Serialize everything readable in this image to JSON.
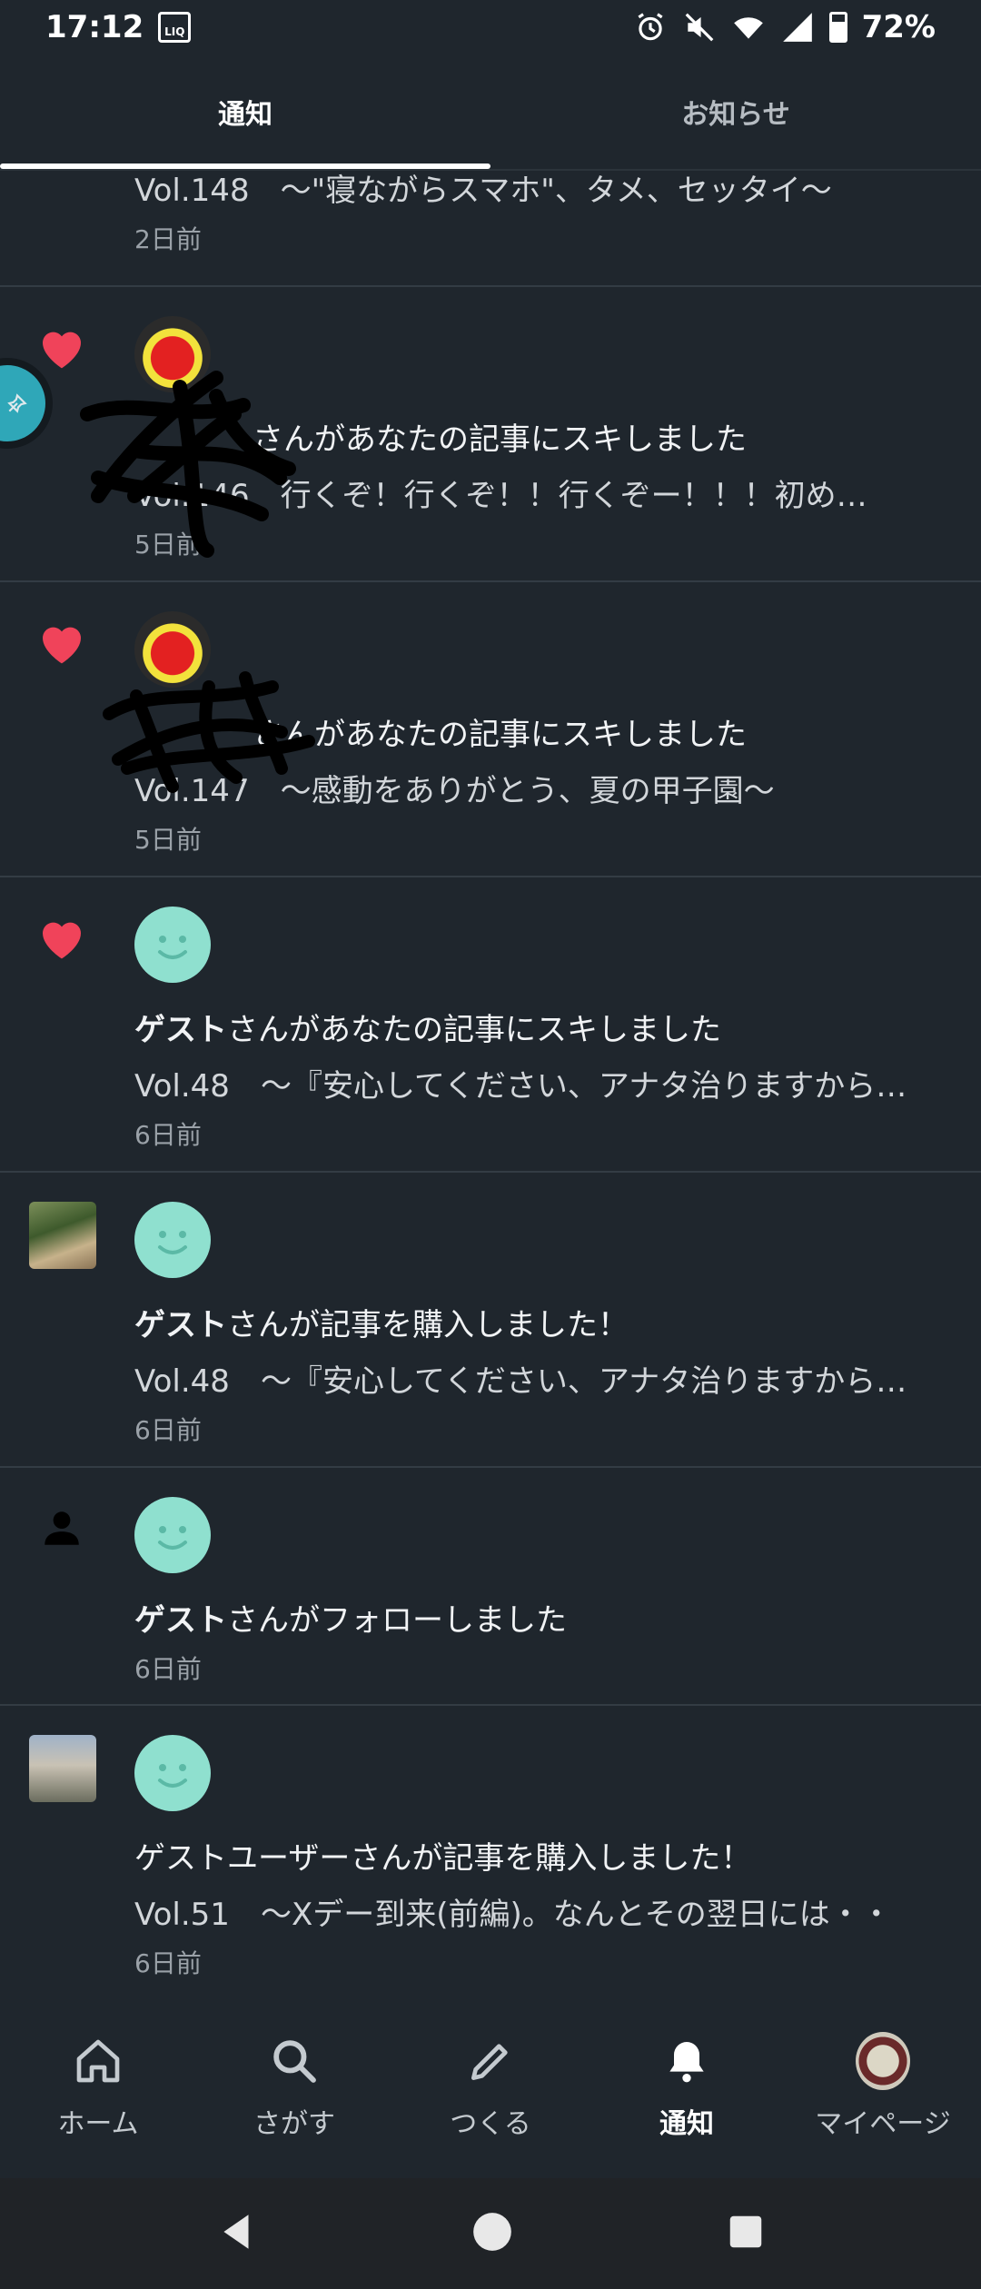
{
  "status_bar": {
    "time": "17:12",
    "liq_label": "LIQ",
    "battery": "72%"
  },
  "tabs": [
    {
      "label": "通知",
      "active": true
    },
    {
      "label": "お知らせ",
      "active": false
    }
  ],
  "notifications": [
    {
      "type": "partial",
      "subtitle": "Vol.148　〜\"寝ながらスマホ\"、タメ、セッタイ〜",
      "time": "2日前"
    },
    {
      "type": "like",
      "actor": "",
      "action": "さんがあなたの記事にスキしました",
      "subtitle": "Vol.146　行くぞ！行くぞ！！行くぞー！！！初め…",
      "time": "5日前",
      "avatar": "demon"
    },
    {
      "type": "like",
      "actor": "",
      "action": "さんがあなたの記事にスキしました",
      "subtitle": "Vol.147　〜感動をありがとう、夏の甲子園〜",
      "time": "5日前",
      "avatar": "demon"
    },
    {
      "type": "like",
      "actor": "ゲスト",
      "action": "さんがあなたの記事にスキしました",
      "subtitle": "Vol.48　〜『安心してください、アナタ治りますから…",
      "time": "6日前",
      "avatar": "guest"
    },
    {
      "type": "purchase",
      "actor": "ゲスト",
      "action": "さんが記事を購入しました！",
      "subtitle": "Vol.48　〜『安心してください、アナタ治りますから…",
      "time": "6日前",
      "avatar": "guest"
    },
    {
      "type": "follow",
      "actor": "ゲスト",
      "action": "さんがフォローしました",
      "subtitle": "",
      "time": "6日前",
      "avatar": "guest"
    },
    {
      "type": "purchase",
      "actor": "",
      "action": "ゲストユーザーさんが記事を購入しました！",
      "subtitle": "Vol.51　〜Xデー到来(前編)。なんとその翌日には・・",
      "time": "6日前",
      "avatar": "guest"
    }
  ],
  "bottom_nav": [
    {
      "label": "ホーム",
      "icon": "home-icon",
      "active": false
    },
    {
      "label": "さがす",
      "icon": "search-icon",
      "active": false
    },
    {
      "label": "つくる",
      "icon": "pencil-icon",
      "active": false
    },
    {
      "label": "通知",
      "icon": "bell-icon",
      "active": true
    },
    {
      "label": "マイページ",
      "icon": "avatar",
      "active": false
    }
  ],
  "colors": {
    "background": "#1f262d",
    "heart": "#f0435a",
    "guest_avatar": "#8fe0cf",
    "divider": "#333c44"
  }
}
